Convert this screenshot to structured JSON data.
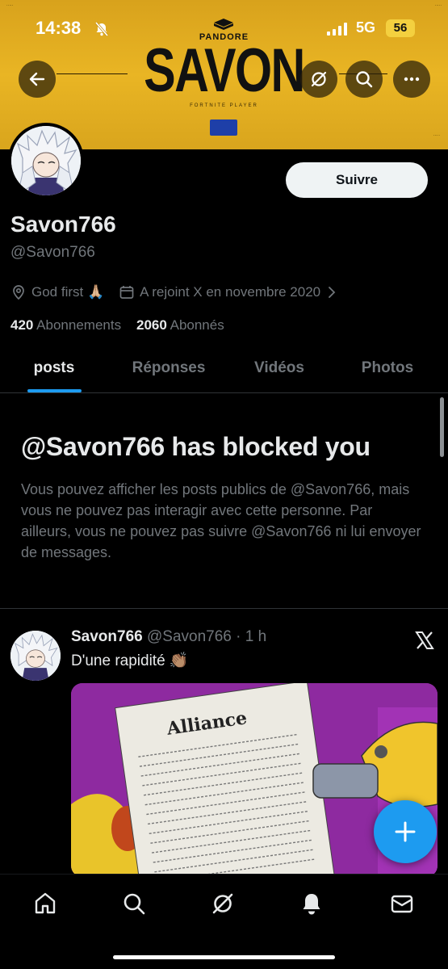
{
  "status_bar": {
    "time": "14:38",
    "network": "5G",
    "battery": "56"
  },
  "banner": {
    "brand": "PANDORE",
    "title": "SAVON",
    "subtitle": "FORTNITE PLAYER",
    "colors": {
      "gold": "#e9b524",
      "dark": "#111111"
    }
  },
  "profile": {
    "follow_label": "Suivre",
    "display_name": "Savon766",
    "handle": "@Savon766",
    "location": "God first 🙏🏼",
    "joined": "A rejoint X en novembre 2020",
    "following_count": "420",
    "following_label": "Abonnements",
    "followers_count": "2060",
    "followers_label": "Abonnés"
  },
  "tabs": [
    {
      "label": "posts",
      "active": true
    },
    {
      "label": "Réponses",
      "active": false
    },
    {
      "label": "Vidéos",
      "active": false
    },
    {
      "label": "Photos",
      "active": false
    }
  ],
  "blocked": {
    "title": "@Savon766 has blocked you",
    "body": "Vous pouvez afficher les posts publics de @Savon766, mais vous ne pouvez pas interagir avec cette personne. Par ailleurs, vous ne pouvez pas suivre @Savon766 ni lui envoyer de messages."
  },
  "post": {
    "author": "Savon766",
    "handle": "@Savon766",
    "time": "· 1 h",
    "text": "D'une rapidité 👏🏽",
    "media_text": "Alliance"
  },
  "icons": {
    "header": [
      "back-arrow-icon",
      "grok-icon",
      "search-icon",
      "more-icon"
    ],
    "nav": [
      "home-icon",
      "search-icon",
      "grok-icon",
      "notifications-icon",
      "messages-icon"
    ]
  },
  "accent_color": "#1d9bf0"
}
